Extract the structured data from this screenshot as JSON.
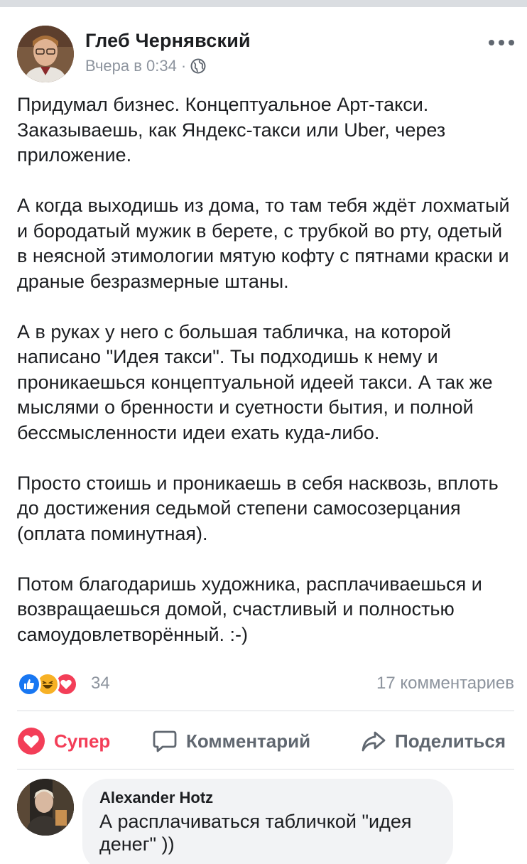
{
  "post": {
    "author": "Глеб Чернявский",
    "timestamp": "Вчера в 0:34",
    "separator": "·",
    "privacy_icon": "globe-icon",
    "more_icon": "more-dots-icon",
    "paragraphs": [
      "Придумал бизнес. Концептуальное Арт-такси. Заказываешь, как Яндекс-такси или Uber, через приложение.",
      "А когда выходишь из дома, то там тебя ждёт лохматый и бородатый мужик в берете, с трубкой во рту, одетый в неясной этимологии мятую кофту с пятнами краски и драные безразмерные штаны.",
      "А в руках у него с большая табличка, на которой написано \"Идея такси\". Ты подходишь к нему и проникаешься концептуальной идеей такси. А так же мыслями о бренности и суетности бытия, и полной бессмысленности идеи ехать куда-либо.",
      "Просто стоишь и проникаешь в себя насквозь, вплоть до достижения седьмой степени самосозерцания (оплата поминутная).",
      "Потом благодаришь художника, расплачиваешься и возвращаешься домой, счастливый и полностью самоудовлетворённый. :-)"
    ]
  },
  "reactions": {
    "icons": [
      "like-icon",
      "haha-icon",
      "love-icon"
    ],
    "count": "34",
    "comments": "17 комментариев"
  },
  "actions": {
    "love_label": "Супер",
    "comment_label": "Комментарий",
    "share_label": "Поделиться"
  },
  "comment": {
    "author": "Alexander Hotz",
    "line1": "А расплачиваться табличкой \"идея",
    "line2": "денег\" ))"
  },
  "colors": {
    "like": "#1877f2",
    "haha": "#f7b125",
    "love": "#f33e58",
    "secondary_text": "#8d949e"
  }
}
